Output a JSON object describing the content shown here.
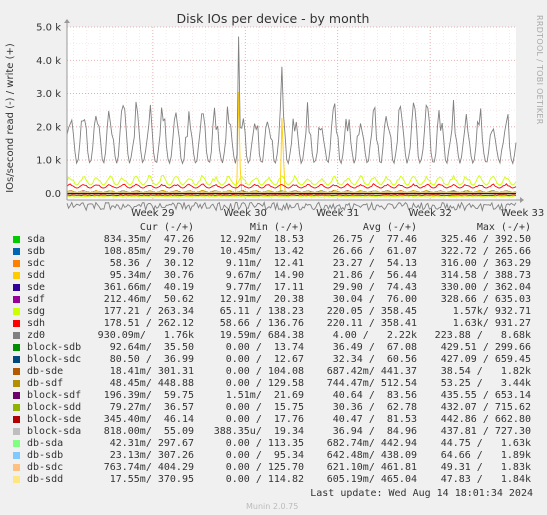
{
  "chart_data": {
    "type": "line",
    "title": "Disk IOs per device - by month",
    "ylabel": "IOs/second read (-) / write (+)",
    "watermark": "RRDTOOL / TOBI OETIKER",
    "ylim": [
      -200,
      5000
    ],
    "yticks": [
      {
        "v": 0,
        "label": "0.0"
      },
      {
        "v": 1000,
        "label": "1.0 k"
      },
      {
        "v": 2000,
        "label": "2.0 k"
      },
      {
        "v": 3000,
        "label": "3.0 k"
      },
      {
        "v": 4000,
        "label": "4.0 k"
      },
      {
        "v": 5000,
        "label": "5.0 k"
      }
    ],
    "x_unit": "days",
    "xlim": [
      0,
      34
    ],
    "xticks": [
      {
        "v": 6.5,
        "label": "Week 29"
      },
      {
        "v": 13.5,
        "label": "Week 30"
      },
      {
        "v": 20.5,
        "label": "Week 31"
      },
      {
        "v": 27.5,
        "label": "Week 32"
      },
      {
        "v": 34.5,
        "label": "Week 33"
      }
    ],
    "grid": true,
    "series": [
      {
        "name": "sda",
        "color": "#00cc00",
        "baseline": 25,
        "amp": 40
      },
      {
        "name": "sdb",
        "color": "#0066b3",
        "baseline": 25,
        "amp": 40
      },
      {
        "name": "sdc",
        "color": "#ff8000",
        "baseline": 30,
        "amp": 30
      },
      {
        "name": "sdd",
        "color": "#ffcc00",
        "baseline": 25,
        "amp": 60
      },
      {
        "name": "sde",
        "color": "#330099",
        "baseline": 20,
        "amp": 40
      },
      {
        "name": "sdf",
        "color": "#990099",
        "baseline": 25,
        "amp": 40
      },
      {
        "name": "sdg",
        "color": "#ccff00",
        "baseline": 250,
        "amp": 250
      },
      {
        "name": "sdh",
        "color": "#ff0000",
        "baseline": 160,
        "amp": 110
      },
      {
        "name": "zd0",
        "color": "#808080",
        "baseline": 900,
        "amp": 1600
      },
      {
        "name": "block-sdb",
        "color": "#008f00",
        "baseline": 25,
        "amp": 40
      },
      {
        "name": "block-sdc",
        "color": "#00487d",
        "baseline": 25,
        "amp": 40
      },
      {
        "name": "db-sde",
        "color": "#b35a00",
        "baseline": 20,
        "amp": 20
      },
      {
        "name": "db-sdf",
        "color": "#b38f00",
        "baseline": 20,
        "amp": 20
      },
      {
        "name": "block-sdf",
        "color": "#6b006b",
        "baseline": 25,
        "amp": 40
      },
      {
        "name": "block-sdd",
        "color": "#8fb300",
        "baseline": 25,
        "amp": 40
      },
      {
        "name": "block-sde",
        "color": "#b30000",
        "baseline": 25,
        "amp": 40
      },
      {
        "name": "block-sda",
        "color": "#bebebe",
        "baseline": 25,
        "amp": 40
      },
      {
        "name": "db-sda",
        "color": "#80ff80",
        "baseline": 20,
        "amp": 20
      },
      {
        "name": "db-sdb",
        "color": "#80c9ff",
        "baseline": 20,
        "amp": 20
      },
      {
        "name": "db-sdc",
        "color": "#ffc080",
        "baseline": 20,
        "amp": 20
      },
      {
        "name": "db-sdd",
        "color": "#ffe680",
        "baseline": 20,
        "amp": 20
      }
    ],
    "spikes": [
      {
        "series": "zd0",
        "x": 13.0,
        "y": 4950
      },
      {
        "series": "sdd",
        "x": 13.0,
        "y": 3200
      },
      {
        "series": "zd0",
        "x": 16.3,
        "y": 4700
      },
      {
        "series": "sdd",
        "x": 16.3,
        "y": 2800
      }
    ]
  },
  "legend": {
    "headers": {
      "cur": "Cur (-/+)",
      "min": "Min (-/+)",
      "avg": "Avg (-/+)",
      "max": "Max (-/+)"
    },
    "rows": [
      {
        "name": "sda",
        "cur": "834.35m/  47.26",
        "min": "12.92m/  18.53",
        "avg": "26.75 /  77.46",
        "max": "325.46 / 392.50"
      },
      {
        "name": "sdb",
        "cur": "108.85m/  29.70",
        "min": "10.45m/  13.42",
        "avg": "26.66 /  61.07",
        "max": "322.72 / 265.66"
      },
      {
        "name": "sdc",
        "cur": " 58.36 /  30.12",
        "min": " 9.11m/  12.41",
        "avg": "23.27 /  54.13",
        "max": "316.00 / 363.29"
      },
      {
        "name": "sdd",
        "cur": " 95.34m/  30.76",
        "min": " 9.67m/  14.90",
        "avg": "21.86 /  56.44",
        "max": "314.58 / 388.73"
      },
      {
        "name": "sde",
        "cur": "361.66m/  40.19",
        "min": " 9.77m/  17.11",
        "avg": "29.90 /  74.43",
        "max": "330.00 / 362.04"
      },
      {
        "name": "sdf",
        "cur": "212.46m/  50.62",
        "min": "12.91m/  20.38",
        "avg": "30.04 /  76.00",
        "max": "328.66 / 635.03"
      },
      {
        "name": "sdg",
        "cur": "177.21 / 263.34",
        "min": "65.11 / 138.23",
        "avg": "220.05 / 358.45",
        "max": "1.57k/ 932.71"
      },
      {
        "name": "sdh",
        "cur": "178.51 / 262.12",
        "min": "58.66 / 136.76",
        "avg": "220.11 / 358.41",
        "max": "1.63k/ 931.27"
      },
      {
        "name": "zd0",
        "cur": "930.09m/   1.76k",
        "min": "19.59m/ 684.38",
        "avg": "4.00 /   2.22k",
        "max": "223.88 /   8.68k"
      },
      {
        "name": "block-sdb",
        "cur": " 92.64m/  35.50",
        "min": " 0.00 /  13.74",
        "avg": "36.49 /  67.08",
        "max": "429.51 / 299.66"
      },
      {
        "name": "block-sdc",
        "cur": " 80.50 /  36.99",
        "min": " 0.00 /  12.67",
        "avg": "32.34 /  60.56",
        "max": "427.09 / 659.45"
      },
      {
        "name": "db-sde",
        "cur": " 18.41m/ 301.31",
        "min": " 0.00 / 104.08",
        "avg": "687.42m/ 441.37",
        "max": "38.54 /   1.82k"
      },
      {
        "name": "db-sdf",
        "cur": " 48.45m/ 448.88",
        "min": " 0.00 / 129.58",
        "avg": "744.47m/ 512.54",
        "max": "53.25 /   3.44k"
      },
      {
        "name": "block-sdf",
        "cur": "196.39m/  59.75",
        "min": " 1.51m/  21.69",
        "avg": "40.64 /  83.56",
        "max": "435.55 / 653.14"
      },
      {
        "name": "block-sdd",
        "cur": " 79.27m/  36.57",
        "min": " 0.00 /  15.75",
        "avg": "30.36 /  62.78",
        "max": "432.07 / 715.62"
      },
      {
        "name": "block-sde",
        "cur": "345.40m/  46.14",
        "min": " 0.00 /  17.76",
        "avg": "40.47 /  81.53",
        "max": "442.86 / 662.80"
      },
      {
        "name": "block-sda",
        "cur": "818.00m/  55.09",
        "min": "388.35u/  19.34",
        "avg": "36.94 /  84.96",
        "max": "437.81 / 727.30"
      },
      {
        "name": "db-sda",
        "cur": " 42.31m/ 297.67",
        "min": " 0.00 / 113.35",
        "avg": "682.74m/ 442.94",
        "max": "44.75 /   1.63k"
      },
      {
        "name": "db-sdb",
        "cur": " 23.13m/ 307.26",
        "min": " 0.00 /  95.34",
        "avg": "642.48m/ 438.09",
        "max": "64.66 /   1.89k"
      },
      {
        "name": "db-sdc",
        "cur": "763.74m/ 404.29",
        "min": " 0.00 / 125.70",
        "avg": "621.10m/ 461.81",
        "max": "49.31 /   1.83k"
      },
      {
        "name": "db-sdd",
        "cur": " 17.55m/ 370.95",
        "min": " 0.00 / 114.82",
        "avg": "605.19m/ 465.04",
        "max": "47.83 /   1.84k"
      }
    ]
  },
  "footer": {
    "last_update": "Last update: Wed Aug 14 18:01:34 2024",
    "version": "Munin 2.0.75"
  }
}
